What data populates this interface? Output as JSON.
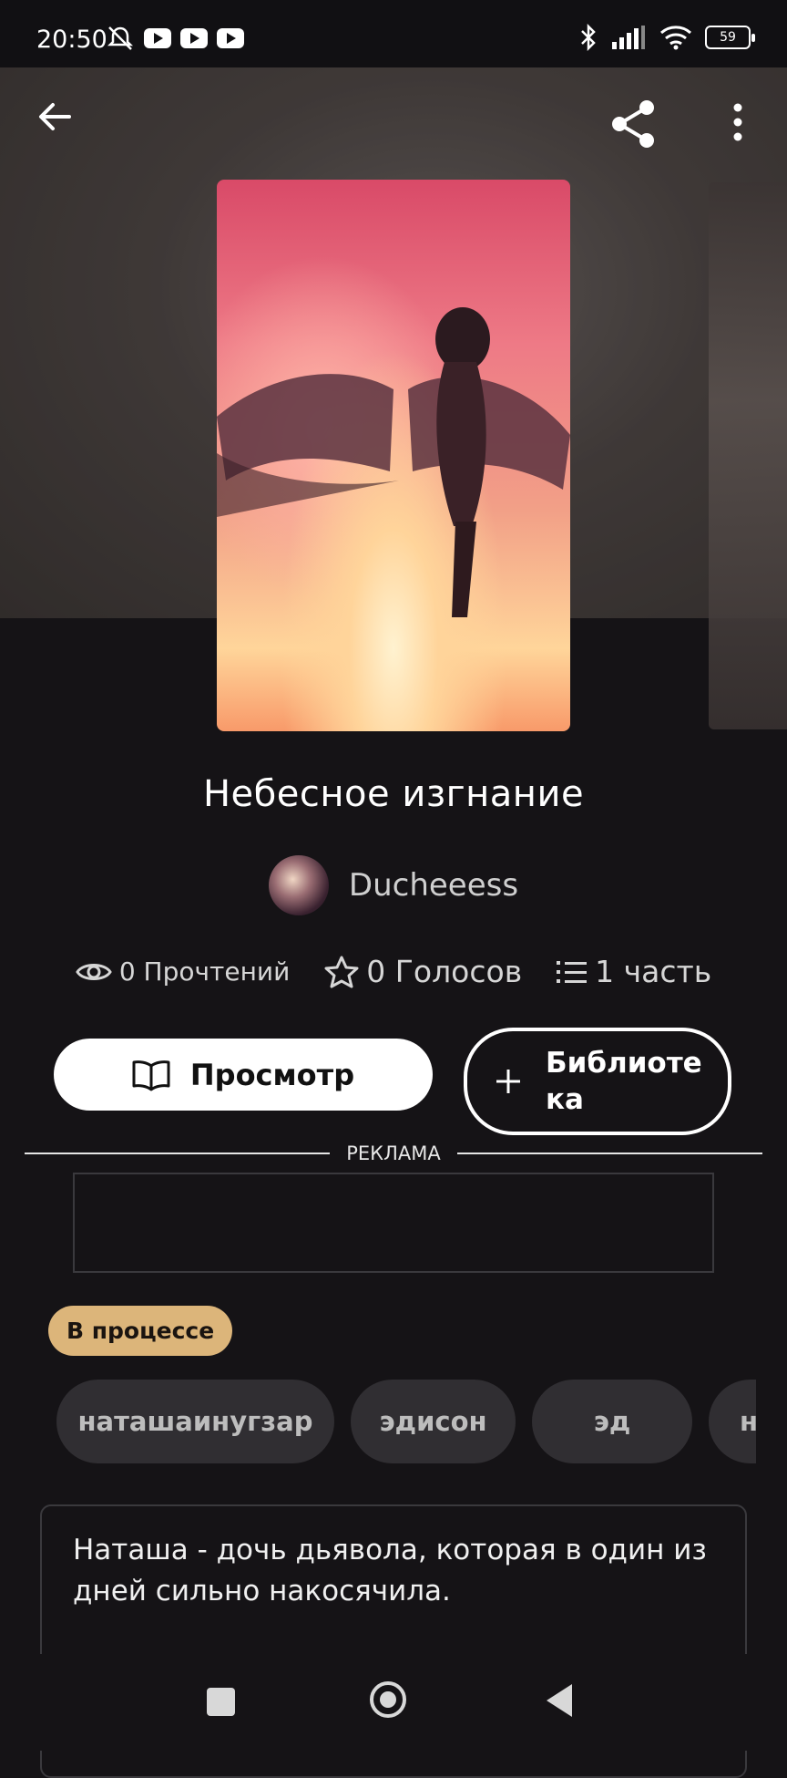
{
  "status_bar": {
    "time": "20:50",
    "battery": "59"
  },
  "book": {
    "title": "Небесное изгнание",
    "author": "Ducheeess",
    "reads": "0 Прочтений",
    "votes": "0 Голосов",
    "parts": "1 часть",
    "status": "В процессе",
    "description": "Наташа - дочь дьявола, которая в один из дней сильно накосячила."
  },
  "actions": {
    "view_label": "Просмотр",
    "library_label": "Библиотека"
  },
  "ad": {
    "label": "РЕКЛАМА"
  },
  "tags": [
    "наташаинугзар",
    "эдисон",
    "эд",
    "н"
  ],
  "colors": {
    "background": "#151316",
    "status_chip": "#dcb57a",
    "tag_bg": "#302e32"
  },
  "icons": [
    "back-arrow-icon",
    "share-icon",
    "more-vertical-icon",
    "eye-icon",
    "star-icon",
    "list-icon",
    "book-open-icon",
    "plus-icon"
  ]
}
